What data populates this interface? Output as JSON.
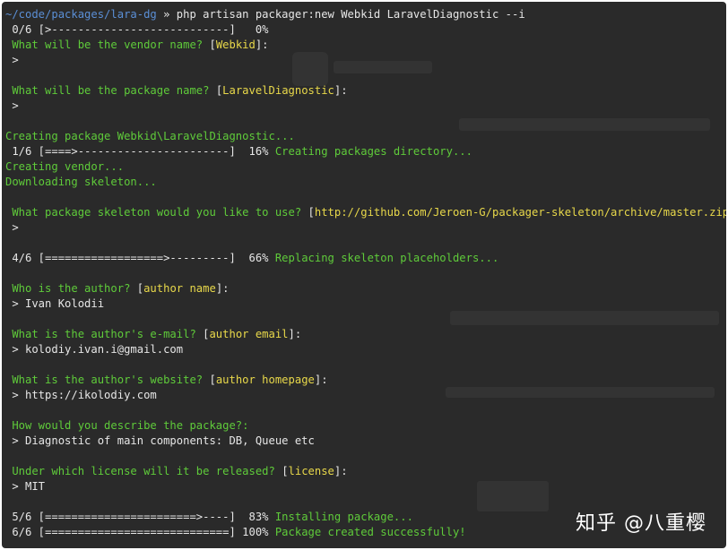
{
  "terminal": {
    "lines": [
      [
        {
          "t": "~/code/packages/lara-dg",
          "c": "p"
        },
        {
          "t": " » php artisan packager:new Webkid LaravelDiagnostic --i",
          "c": "w"
        }
      ],
      [
        {
          "t": " 0/6 [>---------------------------]   0%",
          "c": "w"
        }
      ],
      [
        {
          "t": " What will be the vendor name? ",
          "c": "g"
        },
        {
          "t": "[",
          "c": "w"
        },
        {
          "t": "Webkid",
          "c": "y"
        },
        {
          "t": "]:",
          "c": "w"
        }
      ],
      [
        {
          "t": " >",
          "c": "w"
        }
      ],
      [],
      [
        {
          "t": " What will be the package name? ",
          "c": "g"
        },
        {
          "t": "[",
          "c": "w"
        },
        {
          "t": "LaravelDiagnostic",
          "c": "y"
        },
        {
          "t": "]:",
          "c": "w"
        }
      ],
      [
        {
          "t": " >",
          "c": "w"
        }
      ],
      [],
      [
        {
          "t": "Creating package Webkid\\LaravelDiagnostic...",
          "c": "g"
        }
      ],
      [
        {
          "t": " 1/6 [====>-----------------------]  16% ",
          "c": "w"
        },
        {
          "t": "Creating packages directory...",
          "c": "g"
        }
      ],
      [
        {
          "t": "Creating vendor...",
          "c": "g"
        }
      ],
      [
        {
          "t": "Downloading skeleton...",
          "c": "g"
        }
      ],
      [],
      [
        {
          "t": " What package skeleton would you like to use? ",
          "c": "g"
        },
        {
          "t": "[",
          "c": "w"
        },
        {
          "t": "http://github.com/Jeroen-G/packager-skeleton/archive/master.zip",
          "c": "y"
        },
        {
          "t": "]:",
          "c": "w"
        }
      ],
      [
        {
          "t": " >",
          "c": "w"
        }
      ],
      [],
      [
        {
          "t": " 4/6 [==================>---------]  66% ",
          "c": "w"
        },
        {
          "t": "Replacing skeleton placeholders...",
          "c": "g"
        }
      ],
      [],
      [
        {
          "t": " Who is the author? ",
          "c": "g"
        },
        {
          "t": "[",
          "c": "w"
        },
        {
          "t": "author name",
          "c": "y"
        },
        {
          "t": "]:",
          "c": "w"
        }
      ],
      [
        {
          "t": " > Ivan Kolodii",
          "c": "w"
        }
      ],
      [],
      [
        {
          "t": " What is the author's e-mail? ",
          "c": "g"
        },
        {
          "t": "[",
          "c": "w"
        },
        {
          "t": "author email",
          "c": "y"
        },
        {
          "t": "]:",
          "c": "w"
        }
      ],
      [
        {
          "t": " > kolodiy.ivan.i@gmail.com",
          "c": "w"
        }
      ],
      [],
      [
        {
          "t": " What is the author's website? ",
          "c": "g"
        },
        {
          "t": "[",
          "c": "w"
        },
        {
          "t": "author homepage",
          "c": "y"
        },
        {
          "t": "]:",
          "c": "w"
        }
      ],
      [
        {
          "t": " > https://ikolodiy.com",
          "c": "w"
        }
      ],
      [],
      [
        {
          "t": " How would you describe the package?:",
          "c": "g"
        }
      ],
      [
        {
          "t": " > Diagnostic of main components: DB, Queue etc",
          "c": "w"
        }
      ],
      [],
      [
        {
          "t": " Under which license will it be released? ",
          "c": "g"
        },
        {
          "t": "[",
          "c": "w"
        },
        {
          "t": "license",
          "c": "y"
        },
        {
          "t": "]:",
          "c": "w"
        }
      ],
      [
        {
          "t": " > MIT",
          "c": "w"
        }
      ],
      [],
      [
        {
          "t": " 5/6 [=======================>----]  83% ",
          "c": "w"
        },
        {
          "t": "Installing package...",
          "c": "g"
        }
      ],
      [
        {
          "t": " 6/6 [============================] 100% ",
          "c": "w"
        },
        {
          "t": "Package created successfully!",
          "c": "g"
        }
      ]
    ]
  },
  "watermark": "知乎 @八重樱",
  "colors": {
    "background": "#2a2a2a",
    "text": "#e6e6e6",
    "green": "#5fcb3a",
    "yellow": "#e8d84a",
    "path_blue": "#5b8fd6"
  }
}
